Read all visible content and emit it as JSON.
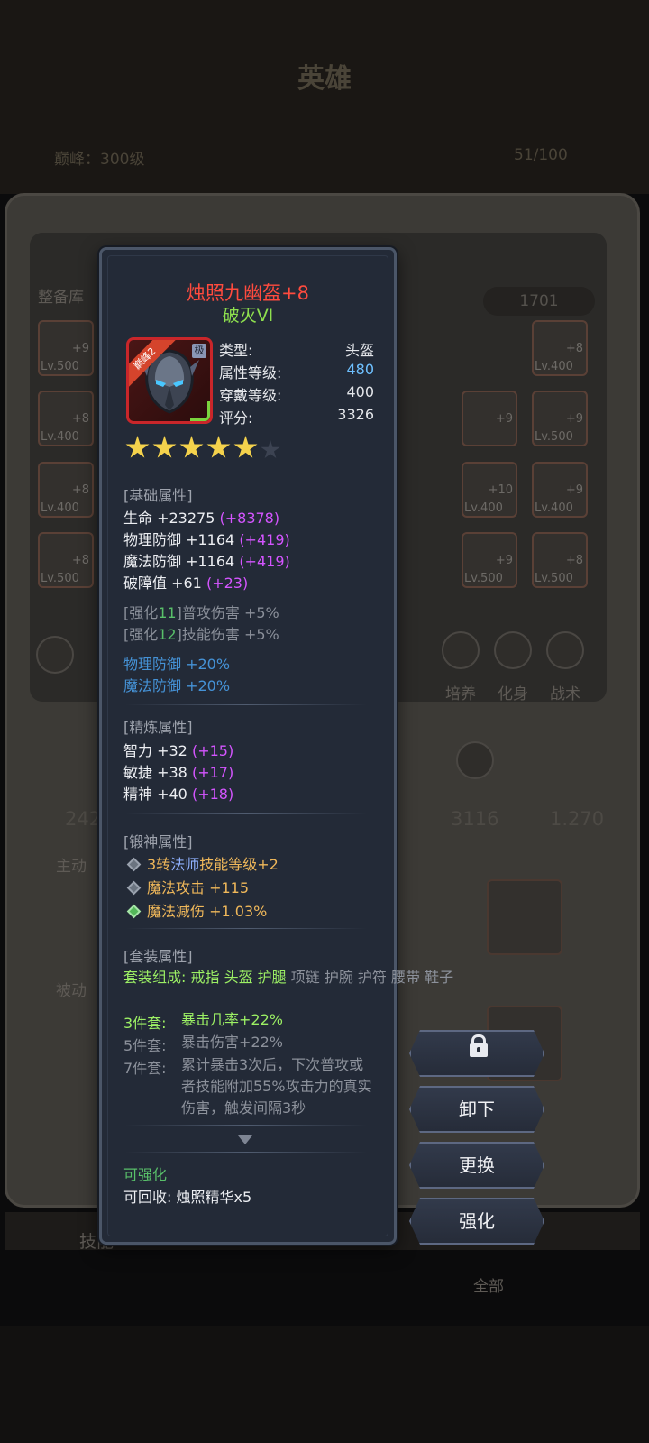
{
  "background": {
    "title": "英雄",
    "peak": "巅峰：300级",
    "count": "51/100",
    "armory": "整备库",
    "score_badge": "1701",
    "slots_left": [
      {
        "lv": "Lv.500",
        "plus": "+9"
      },
      {
        "lv": "Lv.400",
        "plus": "+8"
      },
      {
        "lv": "Lv.400",
        "plus": "+8"
      },
      {
        "lv": "Lv.500",
        "plus": "+8"
      }
    ],
    "slots_right": [
      {
        "lv": "Lv.400",
        "plus": "+8"
      },
      {
        "lv": "Lv.500",
        "plus": "+9"
      },
      {
        "lv": "Lv.400",
        "plus": "+9"
      },
      {
        "lv": "Lv.400",
        "plus": "+10"
      },
      {
        "lv": "Lv.500",
        "plus": "+9"
      },
      {
        "lv": "Lv.500",
        "plus": "+8"
      }
    ],
    "side_labels": {
      "train": "培养",
      "avatar": "化身",
      "tactics": "战术"
    },
    "stats": {
      "left": "242",
      "mid": "3116",
      "right": "1.270"
    },
    "active_label": "主动",
    "passive_label": "被动",
    "skill_tab": "技能",
    "all_label": "全部"
  },
  "item": {
    "name": "烛照九幽盔+8",
    "subtitle": "破灭VI",
    "ribbon": "巅峰2",
    "tag": "极",
    "info": [
      {
        "label": "类型:",
        "value": "头盔"
      },
      {
        "label": "属性等级:",
        "value": "480"
      },
      {
        "label": "穿戴等级:",
        "value": "400"
      },
      {
        "label": "评分:",
        "value": "3326"
      }
    ],
    "stars_filled": 5,
    "stars_total": 6,
    "base": {
      "title": "[基础属性]",
      "lines": [
        {
          "text": "生命 +23275 ",
          "bonus": "(+8378)"
        },
        {
          "text": "物理防御 +1164 ",
          "bonus": "(+419)"
        },
        {
          "text": "魔法防御 +1164 ",
          "bonus": "(+419)"
        },
        {
          "text": "破障值 +61 ",
          "bonus": "(+23)"
        }
      ],
      "enhance": [
        {
          "pre": "[强化",
          "num": "11",
          "post": "]普攻伤害 +5%"
        },
        {
          "pre": "[强化",
          "num": "12",
          "post": "]技能伤害 +5%"
        }
      ],
      "bonus_lines": [
        "物理防御 +20%",
        "魔法防御 +20%"
      ]
    },
    "refine": {
      "title": "[精炼属性]",
      "lines": [
        {
          "text": "智力 +32 ",
          "bonus": "(+15)"
        },
        {
          "text": "敏捷 +38 ",
          "bonus": "(+17)"
        },
        {
          "text": "精神 +40 ",
          "bonus": "(+18)"
        }
      ]
    },
    "forge": {
      "title": "[锻神属性]",
      "line1_a": "3转",
      "line1_b": "法师",
      "line1_c": "技能等级+2",
      "line2": "魔法攻击 +115",
      "line3": "魔法减伤 +1.03%"
    },
    "set": {
      "title": "[套装属性]",
      "composition_label": "套装组成: ",
      "owned": "戒指 头盔 护腿",
      "missing": " 项链 护腕 护符 腰带 鞋子",
      "tiers": [
        {
          "label": "3件套:",
          "desc": "暴击几率+22%"
        },
        {
          "label": "5件套:",
          "desc": "暴击伤害+22%"
        },
        {
          "label": "7件套:",
          "desc": "累计暴击3次后，下次普攻或者技能附加55%攻击力的真实伤害，触发间隔3秒"
        }
      ]
    },
    "can_enhance": "可强化",
    "recycle": "可回收: 烛照精华x5"
  },
  "actions": {
    "unequip": "卸下",
    "replace": "更换",
    "enhance": "强化"
  },
  "colors": {
    "item_name": "#ff4b3e",
    "subtitle": "#8ee04e",
    "bonus": "#d455ff",
    "set_owned": "#9cf064"
  }
}
